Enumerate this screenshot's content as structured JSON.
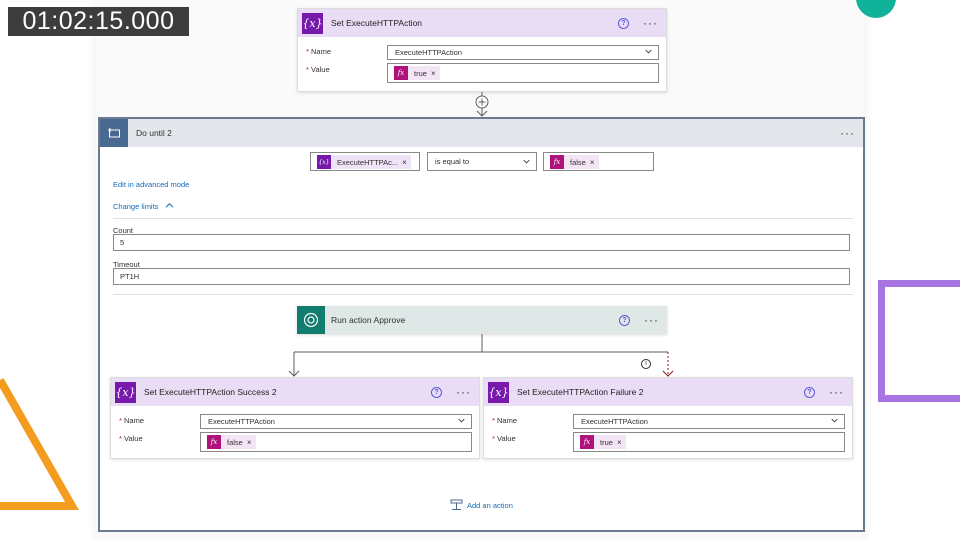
{
  "timecode": "01:02:15.000",
  "colors": {
    "variable": "#7719aa",
    "expression": "#b0127c",
    "loop": "#486991",
    "approval": "#127c6f",
    "link": "#0f6cbd"
  },
  "top_card": {
    "title": "Set ExecuteHTTPAction",
    "icon": "variable-icon",
    "name_label": "Name",
    "name_value": "ExecuteHTTPAction",
    "value_label": "Value",
    "value_token": "true"
  },
  "do_until": {
    "title": "Do until 2",
    "icon": "loop-icon",
    "condition": {
      "left_token": "ExecuteHTTPAc...",
      "operator": "is equal to",
      "right_token": "false"
    },
    "advanced_link": "Edit in advanced mode",
    "limits_link": "Change limits",
    "count_label": "Count",
    "count_value": "5",
    "timeout_label": "Timeout",
    "timeout_value": "PT1H"
  },
  "run_action": {
    "title": "Run action Approve",
    "icon": "approval-icon"
  },
  "success_card": {
    "title": "Set ExecuteHTTPAction Success 2",
    "name_label": "Name",
    "name_value": "ExecuteHTTPAction",
    "value_label": "Value",
    "value_token": "false"
  },
  "failure_card": {
    "title": "Set ExecuteHTTPAction Failure 2",
    "name_label": "Name",
    "name_value": "ExecuteHTTPAction",
    "value_label": "Value",
    "value_token": "true"
  },
  "add_action": "Add an action",
  "glyphs": {
    "var": "{x}",
    "fx": "fx",
    "x": "×",
    "more": "···",
    "help": "?",
    "req": "*",
    "info": "i"
  }
}
